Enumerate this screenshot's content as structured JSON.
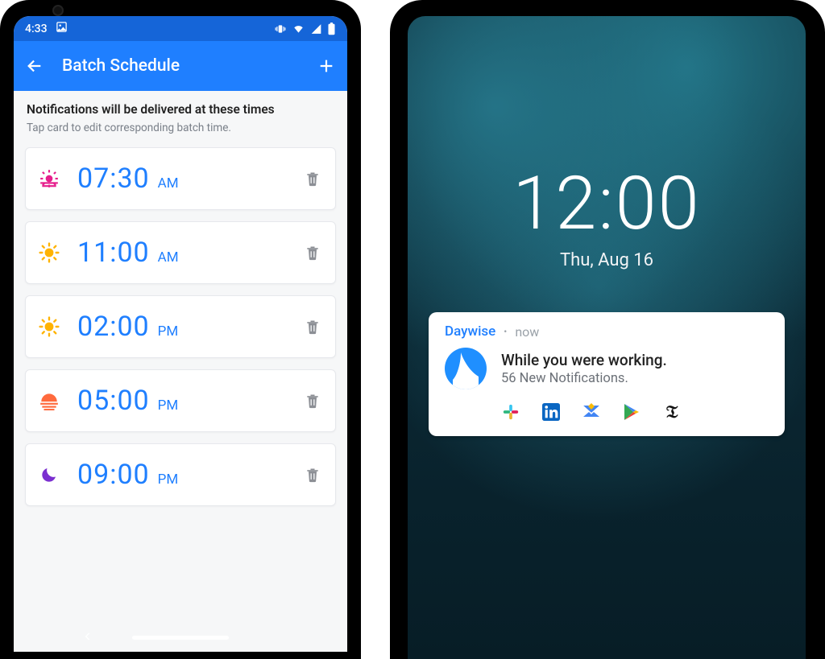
{
  "phone1": {
    "statusbar": {
      "time": "4:33"
    },
    "appbar": {
      "title": "Batch Schedule"
    },
    "intro": {
      "heading": "Notifications will be delivered at these times",
      "subheading": "Tap card to edit corresponding batch time."
    },
    "times": [
      {
        "time": "07:30",
        "ampm": "AM",
        "icon": "sunrise"
      },
      {
        "time": "11:00",
        "ampm": "AM",
        "icon": "sun"
      },
      {
        "time": "02:00",
        "ampm": "PM",
        "icon": "sun"
      },
      {
        "time": "05:00",
        "ampm": "PM",
        "icon": "sunset"
      },
      {
        "time": "09:00",
        "ampm": "PM",
        "icon": "moon"
      }
    ]
  },
  "phone2": {
    "clock": {
      "time": "12:00",
      "date": "Thu, Aug 16"
    },
    "notification": {
      "app_name": "Daywise",
      "when": "now",
      "title": "While you were working.",
      "subtitle": "56 New Notifications.",
      "source_apps": [
        "slack",
        "linkedin",
        "inbox",
        "play-store",
        "nyt"
      ]
    }
  }
}
